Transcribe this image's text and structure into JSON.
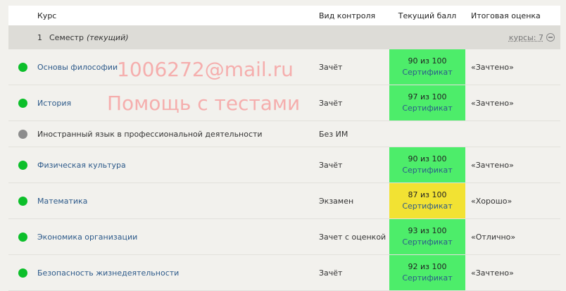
{
  "header": {
    "course": "Курс",
    "control": "Вид контроля",
    "score": "Текущий балл",
    "final": "Итоговая оценка"
  },
  "semester": {
    "number": "1",
    "label": "Семестр",
    "current": "(текущий)",
    "courses_count": "курсы: 7"
  },
  "courses": [
    {
      "name": "Основы философии",
      "control": "Зачёт",
      "score": "90 из 100",
      "cert": "Сертификат",
      "final": "«Зачтено»",
      "status": "green"
    },
    {
      "name": "История",
      "control": "Зачёт",
      "score": "97 из 100",
      "cert": "Сертификат",
      "final": "«Зачтено»",
      "status": "green"
    },
    {
      "name": "Иностранный язык в профессиональной деятельности",
      "control": "Без ИМ",
      "score": "",
      "cert": "",
      "final": "",
      "status": "gray"
    },
    {
      "name": "Физическая культура",
      "control": "Зачёт",
      "score": "90 из 100",
      "cert": "Сертификат",
      "final": "«Зачтено»",
      "status": "green"
    },
    {
      "name": "Математика",
      "control": "Экзамен",
      "score": "87 из 100",
      "cert": "Сертификат",
      "final": "«Хорошо»",
      "status": "green",
      "score_color": "yellow"
    },
    {
      "name": "Экономика организации",
      "control": "Зачет с оценкой",
      "score": "93 из 100",
      "cert": "Сертификат",
      "final": "«Отлично»",
      "status": "green"
    },
    {
      "name": "Безопасность жизнедеятельности",
      "control": "Зачёт",
      "score": "92 из 100",
      "cert": "Сертификат",
      "final": "«Зачтено»",
      "status": "green"
    }
  ],
  "watermark": {
    "line1": "1006272@mail.ru",
    "line2": "Помощь с тестами"
  },
  "colors": {
    "score_green": "#4ded6a",
    "score_yellow": "#f2e233",
    "status_green": "#0cbf2a",
    "status_gray": "#8c8c8c",
    "link": "#2d5a8a"
  }
}
